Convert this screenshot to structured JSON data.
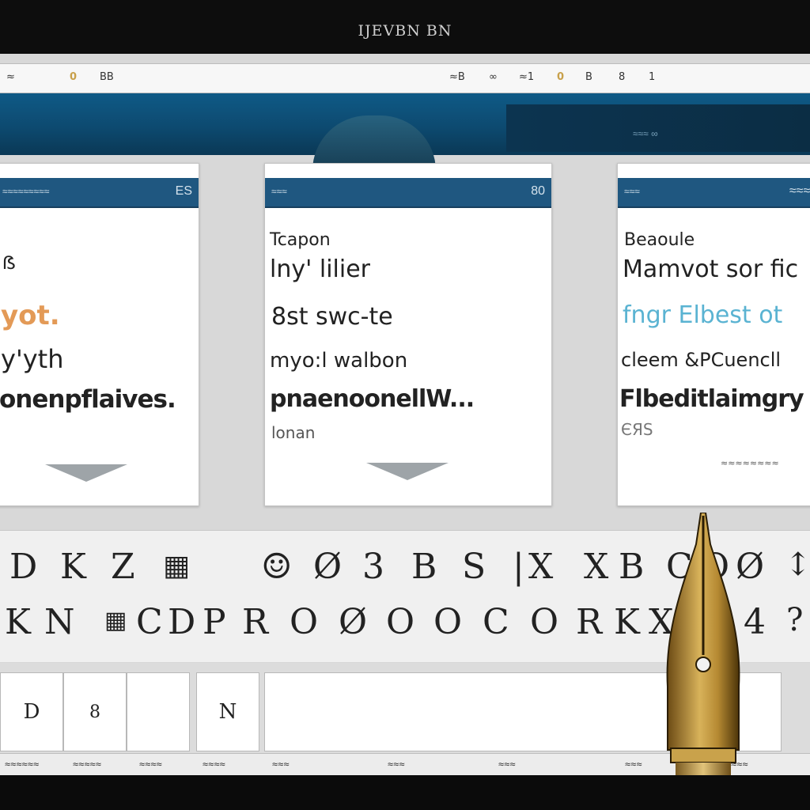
{
  "window": {
    "title": "IJEVBN BN"
  },
  "toolbar": {
    "left_items": [
      "≈",
      "0",
      "BB"
    ],
    "right_items": [
      "≈B",
      "∞",
      "≈1",
      "0",
      "B",
      "8",
      "1"
    ]
  },
  "banner": {
    "right_text": "≈≈≈ ∞"
  },
  "cards": [
    {
      "header_left": "≈≈≈≈≈≈≈≈≈",
      "header_right": "ES",
      "lines": [
        "ẞ",
        "yot.",
        "y'yth",
        "onenpflaives."
      ]
    },
    {
      "header_left": "≈≈≈",
      "header_right": "80",
      "lines": [
        "Tcapon",
        "lny' lilier",
        "8st swc-te",
        "myo:l walbon",
        "pnaenoonellW...",
        "lonan"
      ]
    },
    {
      "header_left": "≈≈≈",
      "header_right": "≈≈≈≈",
      "lines": [
        "Beaoule",
        "Mamvot sor fic",
        "fngr Elbest ot",
        "cleem &PCuencll",
        "Flbeditlaimgry",
        "ЄЯЅ"
      ],
      "footer": "≈≈≈≈≈≈≈≈"
    }
  ],
  "keyboard": {
    "row1": [
      "D",
      "K",
      "Z",
      "▦",
      "☺",
      "Ø",
      "3",
      "B",
      "S",
      "|",
      "X",
      "X",
      "B",
      "C",
      "O",
      "Ø",
      "↕"
    ],
    "row2": [
      "K",
      "N",
      "▦",
      "C",
      "D",
      "P",
      "R",
      "O",
      "Ø",
      "O",
      "O",
      "C",
      "O",
      "R",
      "K",
      "X",
      "4",
      "?"
    ]
  },
  "bottom_buttons": [
    "D",
    "8",
    "",
    "N",
    ""
  ],
  "status": [
    "≈≈≈≈≈≈",
    "≈≈≈≈≈",
    "≈≈≈≈",
    "≈≈≈≈",
    "≈≈≈",
    "≈≈≈",
    "≈≈≈",
    "≈≈≈",
    "≈≈≈"
  ],
  "colors": {
    "banner": "#0f5a86",
    "card_header": "#1f5780",
    "accent_orange": "#e39a57",
    "accent_cyan": "#5ab3d2"
  },
  "icons": {
    "pen": "fountain-pen-icon"
  }
}
